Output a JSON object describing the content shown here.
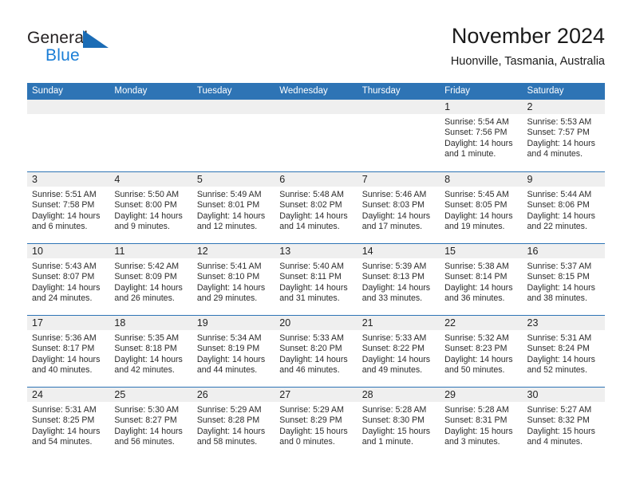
{
  "brand": {
    "name_part1": "General",
    "name_part2": "Blue",
    "triangle_icon": "triangle-icon",
    "accent_color": "#1b7ed6"
  },
  "header": {
    "title": "November 2024",
    "subtitle": "Huonville, Tasmania, Australia"
  },
  "theme": {
    "header_blue": "#2e74b5",
    "daynum_strip_gray": "#efefef",
    "text_color": "#2b2b2b"
  },
  "calendar": {
    "weekday_headers": [
      "Sunday",
      "Monday",
      "Tuesday",
      "Wednesday",
      "Thursday",
      "Friday",
      "Saturday"
    ],
    "weeks": [
      [
        {
          "day": "",
          "lines": []
        },
        {
          "day": "",
          "lines": []
        },
        {
          "day": "",
          "lines": []
        },
        {
          "day": "",
          "lines": []
        },
        {
          "day": "",
          "lines": []
        },
        {
          "day": "1",
          "lines": [
            "Sunrise: 5:54 AM",
            "Sunset: 7:56 PM",
            "Daylight: 14 hours",
            "and 1 minute."
          ]
        },
        {
          "day": "2",
          "lines": [
            "Sunrise: 5:53 AM",
            "Sunset: 7:57 PM",
            "Daylight: 14 hours",
            "and 4 minutes."
          ]
        }
      ],
      [
        {
          "day": "3",
          "lines": [
            "Sunrise: 5:51 AM",
            "Sunset: 7:58 PM",
            "Daylight: 14 hours",
            "and 6 minutes."
          ]
        },
        {
          "day": "4",
          "lines": [
            "Sunrise: 5:50 AM",
            "Sunset: 8:00 PM",
            "Daylight: 14 hours",
            "and 9 minutes."
          ]
        },
        {
          "day": "5",
          "lines": [
            "Sunrise: 5:49 AM",
            "Sunset: 8:01 PM",
            "Daylight: 14 hours",
            "and 12 minutes."
          ]
        },
        {
          "day": "6",
          "lines": [
            "Sunrise: 5:48 AM",
            "Sunset: 8:02 PM",
            "Daylight: 14 hours",
            "and 14 minutes."
          ]
        },
        {
          "day": "7",
          "lines": [
            "Sunrise: 5:46 AM",
            "Sunset: 8:03 PM",
            "Daylight: 14 hours",
            "and 17 minutes."
          ]
        },
        {
          "day": "8",
          "lines": [
            "Sunrise: 5:45 AM",
            "Sunset: 8:05 PM",
            "Daylight: 14 hours",
            "and 19 minutes."
          ]
        },
        {
          "day": "9",
          "lines": [
            "Sunrise: 5:44 AM",
            "Sunset: 8:06 PM",
            "Daylight: 14 hours",
            "and 22 minutes."
          ]
        }
      ],
      [
        {
          "day": "10",
          "lines": [
            "Sunrise: 5:43 AM",
            "Sunset: 8:07 PM",
            "Daylight: 14 hours",
            "and 24 minutes."
          ]
        },
        {
          "day": "11",
          "lines": [
            "Sunrise: 5:42 AM",
            "Sunset: 8:09 PM",
            "Daylight: 14 hours",
            "and 26 minutes."
          ]
        },
        {
          "day": "12",
          "lines": [
            "Sunrise: 5:41 AM",
            "Sunset: 8:10 PM",
            "Daylight: 14 hours",
            "and 29 minutes."
          ]
        },
        {
          "day": "13",
          "lines": [
            "Sunrise: 5:40 AM",
            "Sunset: 8:11 PM",
            "Daylight: 14 hours",
            "and 31 minutes."
          ]
        },
        {
          "day": "14",
          "lines": [
            "Sunrise: 5:39 AM",
            "Sunset: 8:13 PM",
            "Daylight: 14 hours",
            "and 33 minutes."
          ]
        },
        {
          "day": "15",
          "lines": [
            "Sunrise: 5:38 AM",
            "Sunset: 8:14 PM",
            "Daylight: 14 hours",
            "and 36 minutes."
          ]
        },
        {
          "day": "16",
          "lines": [
            "Sunrise: 5:37 AM",
            "Sunset: 8:15 PM",
            "Daylight: 14 hours",
            "and 38 minutes."
          ]
        }
      ],
      [
        {
          "day": "17",
          "lines": [
            "Sunrise: 5:36 AM",
            "Sunset: 8:17 PM",
            "Daylight: 14 hours",
            "and 40 minutes."
          ]
        },
        {
          "day": "18",
          "lines": [
            "Sunrise: 5:35 AM",
            "Sunset: 8:18 PM",
            "Daylight: 14 hours",
            "and 42 minutes."
          ]
        },
        {
          "day": "19",
          "lines": [
            "Sunrise: 5:34 AM",
            "Sunset: 8:19 PM",
            "Daylight: 14 hours",
            "and 44 minutes."
          ]
        },
        {
          "day": "20",
          "lines": [
            "Sunrise: 5:33 AM",
            "Sunset: 8:20 PM",
            "Daylight: 14 hours",
            "and 46 minutes."
          ]
        },
        {
          "day": "21",
          "lines": [
            "Sunrise: 5:33 AM",
            "Sunset: 8:22 PM",
            "Daylight: 14 hours",
            "and 49 minutes."
          ]
        },
        {
          "day": "22",
          "lines": [
            "Sunrise: 5:32 AM",
            "Sunset: 8:23 PM",
            "Daylight: 14 hours",
            "and 50 minutes."
          ]
        },
        {
          "day": "23",
          "lines": [
            "Sunrise: 5:31 AM",
            "Sunset: 8:24 PM",
            "Daylight: 14 hours",
            "and 52 minutes."
          ]
        }
      ],
      [
        {
          "day": "24",
          "lines": [
            "Sunrise: 5:31 AM",
            "Sunset: 8:25 PM",
            "Daylight: 14 hours",
            "and 54 minutes."
          ]
        },
        {
          "day": "25",
          "lines": [
            "Sunrise: 5:30 AM",
            "Sunset: 8:27 PM",
            "Daylight: 14 hours",
            "and 56 minutes."
          ]
        },
        {
          "day": "26",
          "lines": [
            "Sunrise: 5:29 AM",
            "Sunset: 8:28 PM",
            "Daylight: 14 hours",
            "and 58 minutes."
          ]
        },
        {
          "day": "27",
          "lines": [
            "Sunrise: 5:29 AM",
            "Sunset: 8:29 PM",
            "Daylight: 15 hours",
            "and 0 minutes."
          ]
        },
        {
          "day": "28",
          "lines": [
            "Sunrise: 5:28 AM",
            "Sunset: 8:30 PM",
            "Daylight: 15 hours",
            "and 1 minute."
          ]
        },
        {
          "day": "29",
          "lines": [
            "Sunrise: 5:28 AM",
            "Sunset: 8:31 PM",
            "Daylight: 15 hours",
            "and 3 minutes."
          ]
        },
        {
          "day": "30",
          "lines": [
            "Sunrise: 5:27 AM",
            "Sunset: 8:32 PM",
            "Daylight: 15 hours",
            "and 4 minutes."
          ]
        }
      ]
    ]
  }
}
